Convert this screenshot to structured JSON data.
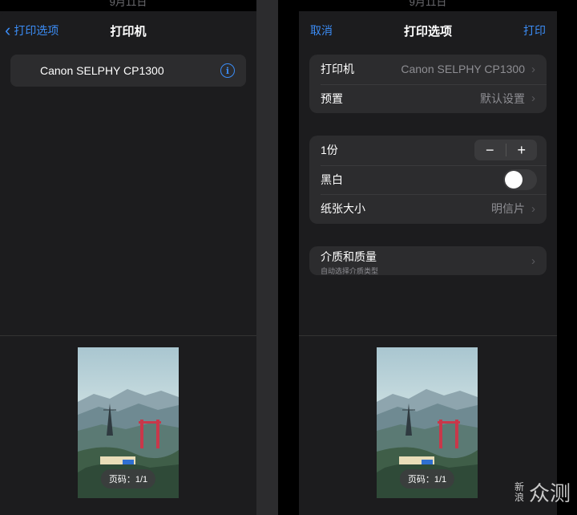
{
  "status": {
    "time": "9月11日"
  },
  "left": {
    "nav": {
      "back_label": "打印选项",
      "title": "打印机"
    },
    "printer": {
      "name": "Canon SELPHY CP1300"
    },
    "preview": {
      "page_badge": "页码：1/1"
    }
  },
  "right": {
    "nav": {
      "cancel_label": "取消",
      "title": "打印选项",
      "print_label": "打印"
    },
    "group1": [
      {
        "label": "打印机",
        "value": "Canon SELPHY CP1300"
      },
      {
        "label": "预置",
        "value": "默认设置"
      }
    ],
    "group2": {
      "copies_label": "1份",
      "minus": "−",
      "plus": "+",
      "bw_label": "黑白",
      "bw_on": false,
      "paper_label": "纸张大小",
      "paper_value": "明信片"
    },
    "group3": {
      "label": "介质和质量",
      "sub": "自动选择介质类型"
    },
    "preview": {
      "page_badge": "页码：1/1"
    }
  },
  "watermark": {
    "small": "新浪",
    "big": "众测"
  },
  "colors": {
    "accent": "#3b8cf5",
    "sheet": "#1c1c1e",
    "cell": "#2c2c2e"
  }
}
